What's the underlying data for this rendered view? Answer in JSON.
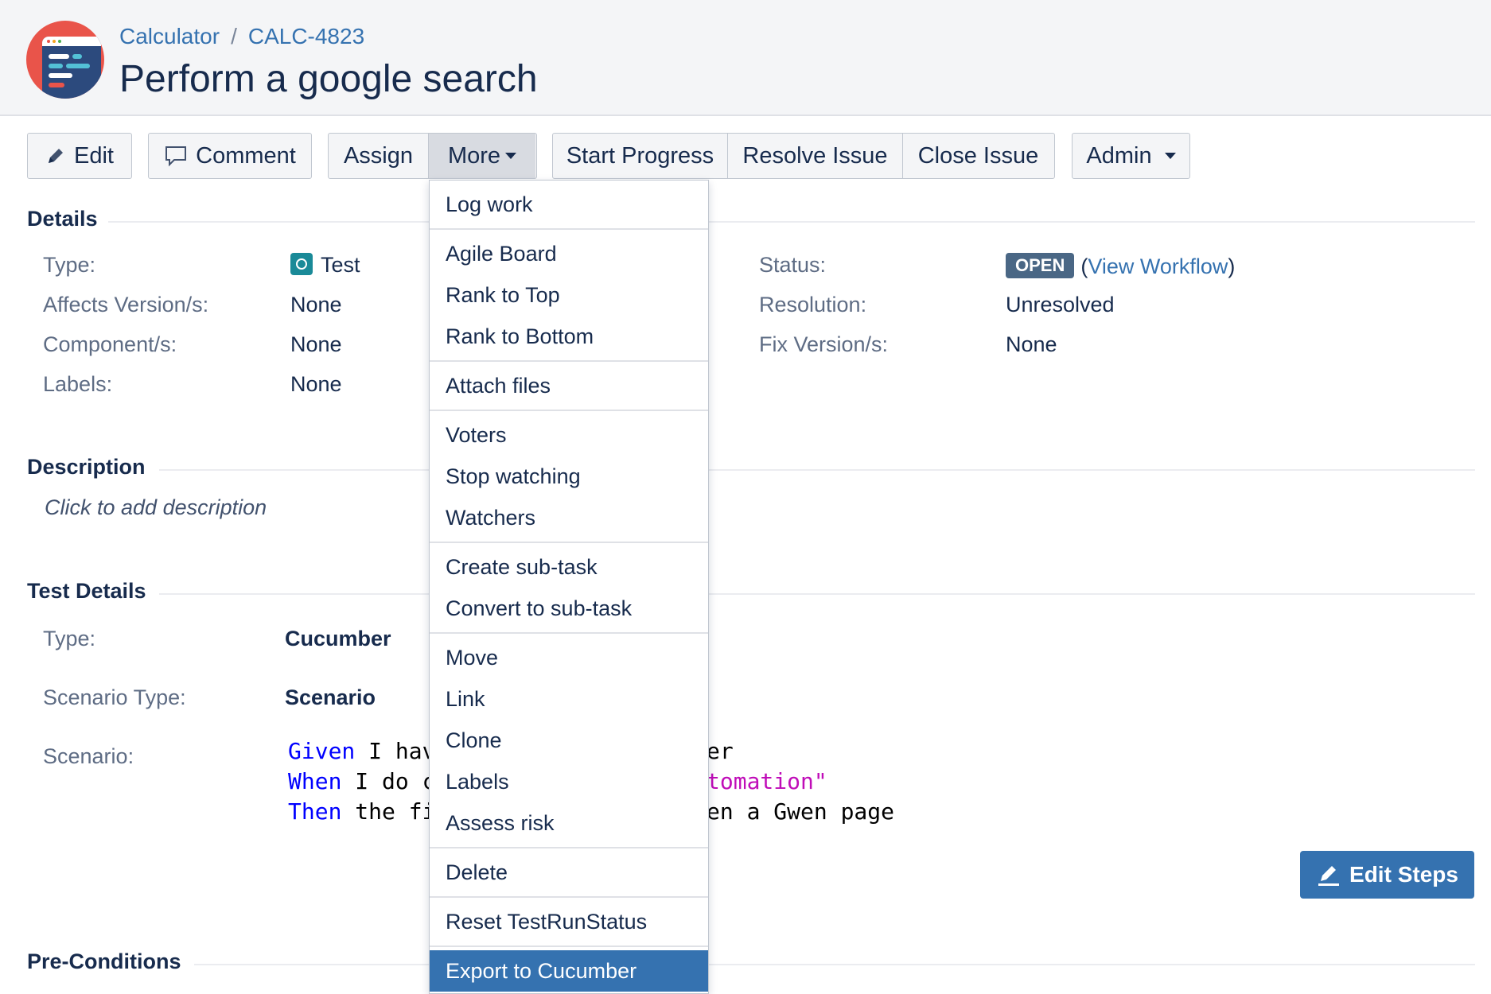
{
  "header": {
    "project": "Calculator",
    "separator": "/",
    "issue_key": "CALC-4823",
    "title": "Perform a google search"
  },
  "toolbar": {
    "edit": "Edit",
    "comment": "Comment",
    "assign": "Assign",
    "more": "More",
    "start_progress": "Start Progress",
    "resolve_issue": "Resolve Issue",
    "close_issue": "Close Issue",
    "admin": "Admin"
  },
  "details": {
    "heading": "Details",
    "type_label": "Type:",
    "type_value": "Test",
    "affects_label": "Affects Version/s:",
    "affects_value": "None",
    "components_label": "Component/s:",
    "components_value": "None",
    "labels_label": "Labels:",
    "labels_value": "None",
    "status_label": "Status:",
    "status_value": "OPEN",
    "view_workflow": "View Workflow",
    "resolution_label": "Resolution:",
    "resolution_value": "Unresolved",
    "fix_label": "Fix Version/s:",
    "fix_value": "None"
  },
  "description": {
    "heading": "Description",
    "placeholder": "Click to add description"
  },
  "test_details": {
    "heading": "Test Details",
    "type_label": "Type:",
    "type_value": "Cucumber",
    "scenario_type_label": "Scenario Type:",
    "scenario_type_value": "Scenario",
    "scenario_label": "Scenario:",
    "line1_kw": "Given",
    "line1_text": " I hav",
    "line1_tail": "er",
    "line2_kw": "When",
    "line2_text": " I do c",
    "line2_tail": "tomation\"",
    "line3_kw": "Then",
    "line3_text": " the fi",
    "line3_tail": "en a Gwen page",
    "edit_steps": "Edit Steps"
  },
  "preconditions": {
    "heading": "Pre-Conditions"
  },
  "more_menu": {
    "groups": [
      [
        "Log work"
      ],
      [
        "Agile Board",
        "Rank to Top",
        "Rank to Bottom"
      ],
      [
        "Attach files"
      ],
      [
        "Voters",
        "Stop watching",
        "Watchers"
      ],
      [
        "Create sub-task",
        "Convert to sub-task"
      ],
      [
        "Move",
        "Link",
        "Clone",
        "Labels",
        "Assess risk"
      ],
      [
        "Delete"
      ],
      [
        "Reset TestRunStatus"
      ],
      [
        "Export to Cucumber"
      ]
    ],
    "highlighted": "Export to Cucumber"
  },
  "colors": {
    "link": "#3572b0",
    "status_badge": "#4a6785",
    "primary_button": "#3572b0",
    "gherkin_keyword": "#0000ff",
    "gherkin_string": "#c00db8"
  },
  "icons": [
    "project-avatar-icon",
    "pencil-icon",
    "speech-bubble-icon",
    "caret-down-icon",
    "test-issue-type-icon"
  ]
}
